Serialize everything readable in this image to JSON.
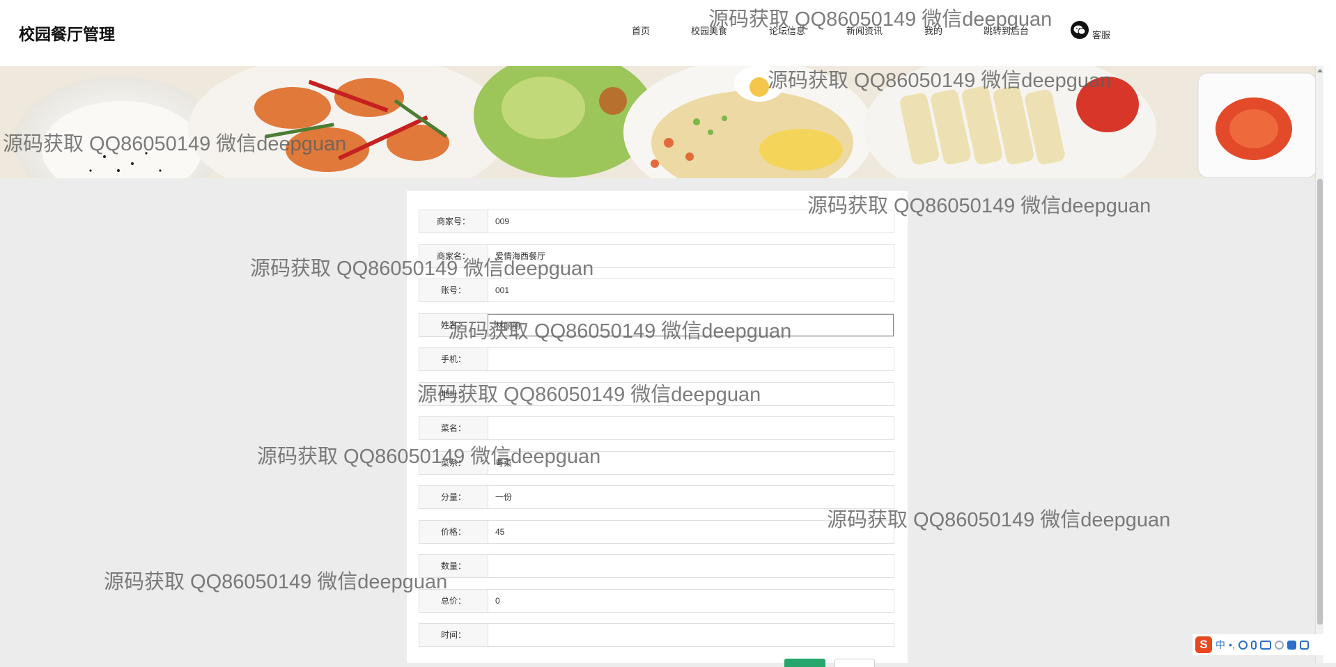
{
  "header": {
    "site_title": "校园餐厅管理",
    "nav": [
      "首页",
      "校园美食",
      "论坛信息",
      "新闻资讯",
      "我的",
      "跳转到后台"
    ],
    "kefu": "客服",
    "wechat_icon": "wechat-icon"
  },
  "form": {
    "fields": [
      {
        "label": "商家号：",
        "value": "009"
      },
      {
        "label": "商家名：",
        "value": "爱情海西餐厅"
      },
      {
        "label": "账号：",
        "value": "001"
      },
      {
        "label": "姓名：",
        "value": "林丽丽"
      },
      {
        "label": "手机：",
        "value": ""
      },
      {
        "label": "地址：",
        "value": ""
      },
      {
        "label": "菜名：",
        "value": ""
      },
      {
        "label": "菜系：",
        "value": "粤菜"
      },
      {
        "label": "分量：",
        "value": "一份"
      },
      {
        "label": "价格：",
        "value": "45"
      },
      {
        "label": "数量：",
        "value": ""
      },
      {
        "label": "总价：",
        "value": "0"
      },
      {
        "label": "时间：",
        "value": ""
      }
    ]
  },
  "watermark": "源码获取 QQ86050149 微信deepguan",
  "ime": {
    "logo": "S",
    "mode": "中",
    "punct": "•,"
  },
  "colors": {
    "submit_button": "#26a66d",
    "page_background": "#ececec"
  }
}
